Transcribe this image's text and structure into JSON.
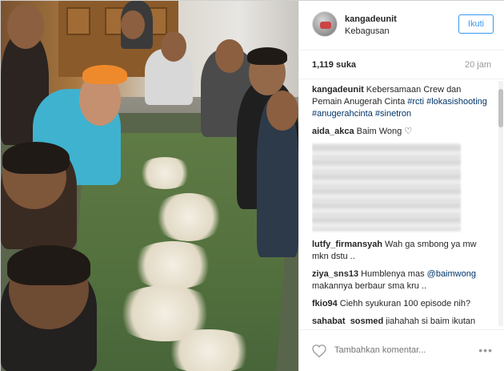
{
  "post": {
    "username": "kangadeunit",
    "location": "Kebagusan",
    "follow_label": "Ikuti",
    "likes": "1,119 suka",
    "time": "20 jam"
  },
  "comments": [
    {
      "user": "kangadeunit",
      "text": "Kebersamaan Crew dan Pemain Anugerah Cinta ",
      "tags": "#rcti #lokasishooting #anugerahcinta #sinetron"
    },
    {
      "user": "aida_akca",
      "text": "Baim Wong ♡"
    },
    {
      "user": "lutfy_firmansyah",
      "text": "Wah ga smbong ya mw mkn dstu .."
    },
    {
      "user": "ziya_sns13",
      "text": "Humblenya mas ",
      "mention": "@baimwong",
      "text2": " makannya berbaur sma kru .."
    },
    {
      "user": "fkio94",
      "text": "Ciehh syukuran 100 episode nih?"
    },
    {
      "user": "sahabat_sosmed",
      "text": "jiahahah si baim ikutan syukuran slametan ma crew Ac nah gtu lah jn sokal/i berbaur ma orang yg crew"
    }
  ],
  "footer": {
    "comment_placeholder": "Tambahkan komentar...",
    "more_label": "•••"
  },
  "icons": {
    "heart": "heart-icon",
    "more": "more-options-icon"
  },
  "colors": {
    "accent": "#3897f0",
    "link": "#003569"
  }
}
